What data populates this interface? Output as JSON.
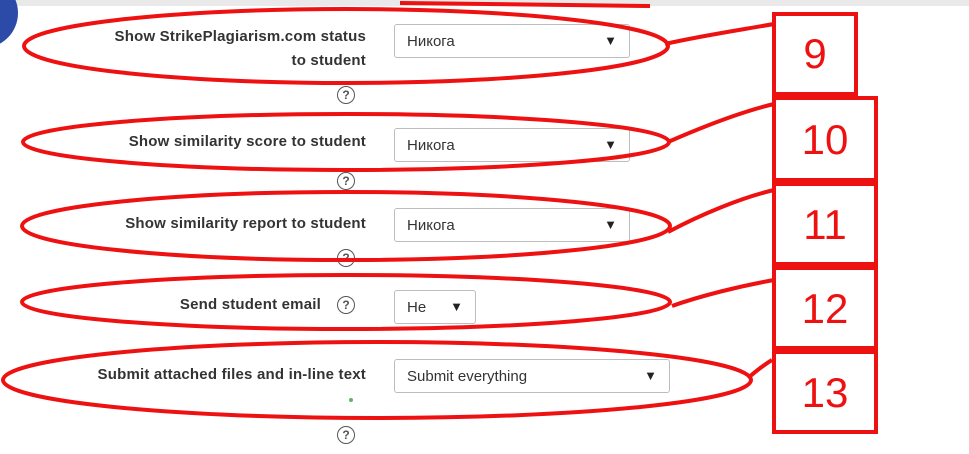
{
  "settings": [
    {
      "label_lines": [
        "Show StrikePlagiarism.com status",
        "to student"
      ],
      "value": "Никога"
    },
    {
      "label_lines": [
        "Show similarity score to student"
      ],
      "value": "Никога"
    },
    {
      "label_lines": [
        "Show similarity report to student"
      ],
      "value": "Никога"
    },
    {
      "label_lines": [
        "Send student email"
      ],
      "value": "Не"
    },
    {
      "label_lines": [
        "Submit attached files and in-line text"
      ],
      "value": "Submit everything"
    }
  ],
  "annotations": [
    "9",
    "10",
    "11",
    "12",
    "13"
  ],
  "icons": {
    "help": "question-circle-icon",
    "caret": "caret-down-icon"
  },
  "colors": {
    "annotation": "#ee1111",
    "required_dot": "#5cb85c"
  }
}
